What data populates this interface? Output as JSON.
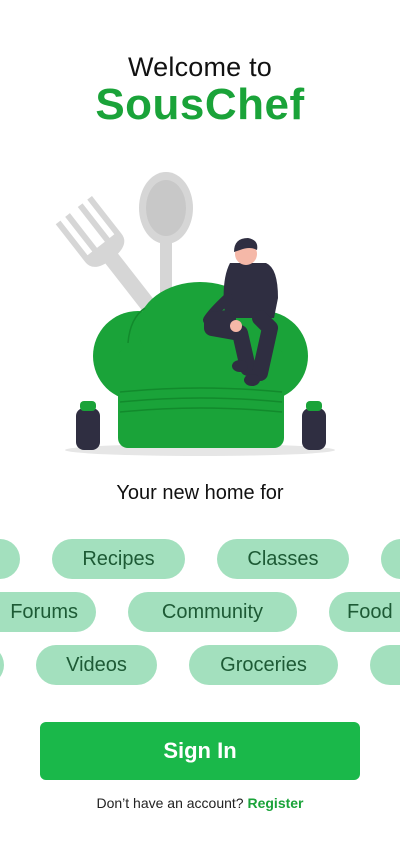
{
  "header": {
    "welcome": "Welcome to",
    "brand": "SousChef"
  },
  "tagline": "Your new home for",
  "chip_rows": [
    [
      "",
      "Recipes",
      "Classes",
      ""
    ],
    [
      "Forums",
      "Community",
      "Food"
    ],
    [
      "",
      "Videos",
      "Groceries",
      ""
    ]
  ],
  "actions": {
    "signin_label": "Sign In",
    "no_account_text": "Don’t have an account?",
    "register_label": "Register"
  },
  "colors": {
    "brand_green": "#1aa339",
    "button_green": "#1ab84a",
    "chip_bg": "#a3e0be",
    "chip_text": "#1d5a35"
  },
  "illustration": {
    "icons": [
      "fork-icon",
      "spoon-icon",
      "chef-hat-icon",
      "salt-shaker-icon",
      "pepper-shaker-icon",
      "person-sitting"
    ]
  }
}
